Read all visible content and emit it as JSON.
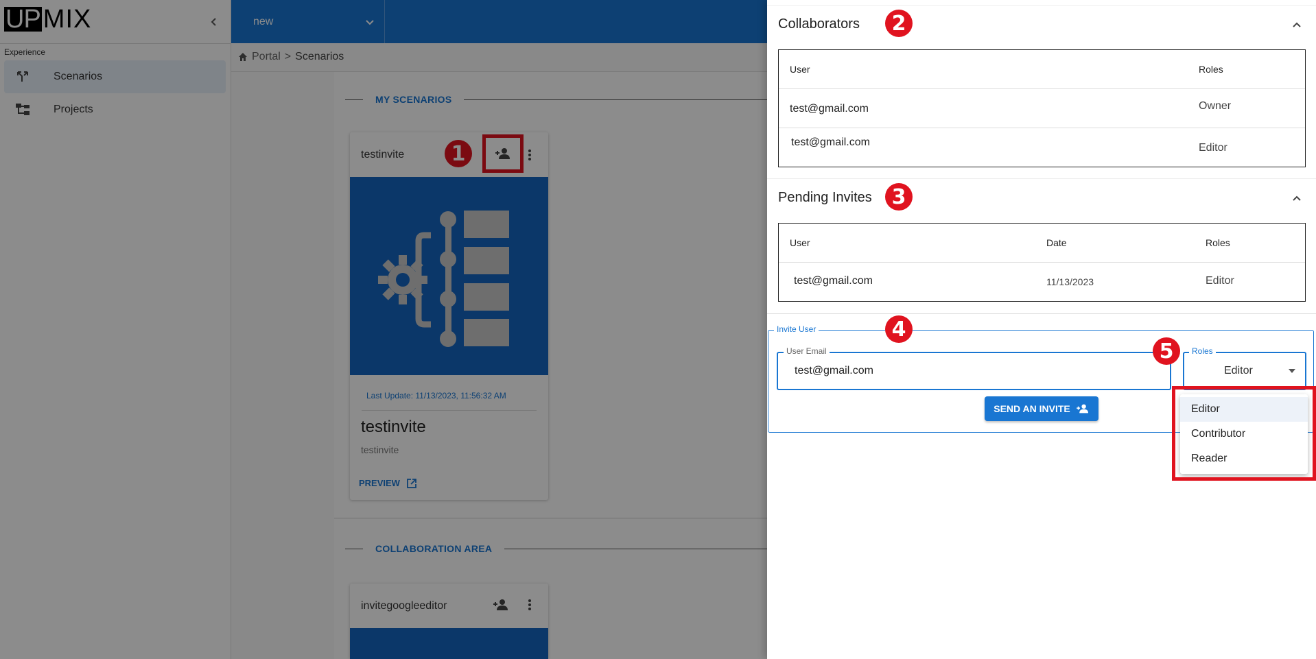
{
  "app": {
    "logo_up": "UP",
    "logo_mix": "MIX"
  },
  "sidebar": {
    "section_label": "Experience",
    "items": [
      {
        "label": "Scenarios",
        "icon": "merge-icon",
        "active": true
      },
      {
        "label": "Projects",
        "icon": "tree-icon",
        "active": false
      }
    ]
  },
  "topbar": {
    "project_select": "new"
  },
  "breadcrumb": {
    "home": "Portal",
    "separator": ">",
    "current": "Scenarios"
  },
  "my_scenarios": {
    "heading": "MY SCENARIOS",
    "card": {
      "title": "testinvite",
      "last_update": "Last Update: 11/13/2023, 11:56:32 AM",
      "name": "testinvite",
      "subtitle": "testinvite",
      "preview_label": "PREVIEW"
    }
  },
  "collaboration_area": {
    "heading": "COLLABORATION AREA",
    "card": {
      "title": "invitegoogleeditor"
    }
  },
  "markers": {
    "m1": "1",
    "m2": "2",
    "m3": "3",
    "m4": "4",
    "m5": "5"
  },
  "drawer": {
    "collaborators": {
      "title": "Collaborators",
      "headers": {
        "user": "User",
        "roles": "Roles"
      },
      "rows": [
        {
          "user": "test@gmail.com",
          "role": "Owner"
        },
        {
          "user": "test@gmail.com",
          "role": "Editor"
        }
      ]
    },
    "pending": {
      "title": "Pending Invites",
      "headers": {
        "user": "User",
        "date": "Date",
        "roles": "Roles"
      },
      "rows": [
        {
          "user": "test@gmail.com",
          "date": "11/13/2023",
          "role": "Editor"
        }
      ]
    },
    "invite": {
      "legend": "Invite User",
      "email_label": "User Email",
      "email_value": "test@gmail.com",
      "roles_label": "Roles",
      "roles_value": "Editor",
      "send_label": "SEND AN INVITE",
      "role_options": [
        "Editor",
        "Contributor",
        "Reader"
      ]
    }
  },
  "colors": {
    "primary": "#1976d2",
    "highlight": "#e0131f"
  }
}
